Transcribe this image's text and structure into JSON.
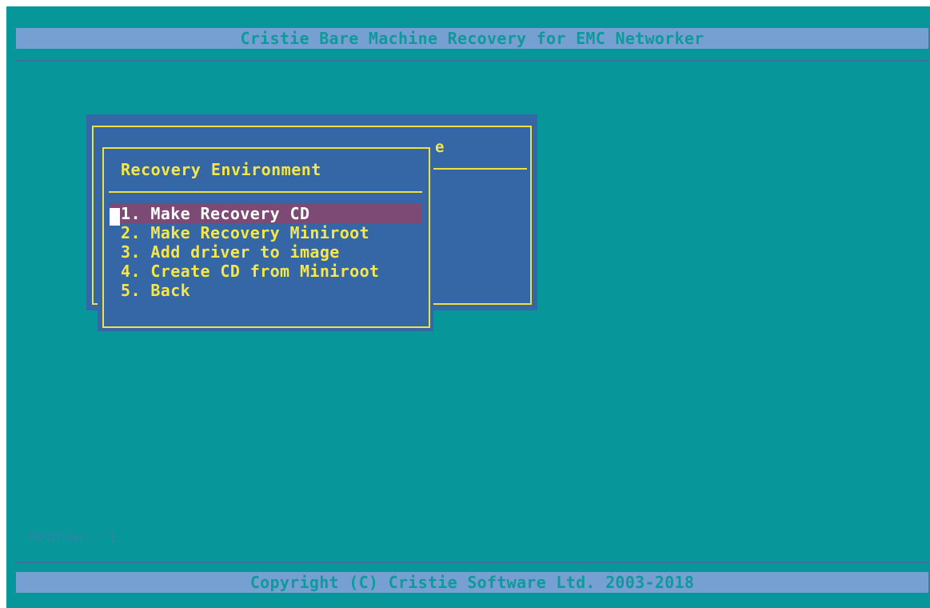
{
  "header": {
    "title": "Cristie Bare Machine Recovery for EMC Networker"
  },
  "footer": {
    "copyright": "Copyright (C) Cristie Software Ltd. 2003-2018",
    "redraw_hint": "Redraw: ^L"
  },
  "back_dialog": {
    "title_fragment": "e"
  },
  "dialog": {
    "title": "Recovery Environment",
    "selected_index": 0,
    "items": [
      {
        "label": "1. Make Recovery CD"
      },
      {
        "label": "2. Make Recovery Miniroot"
      },
      {
        "label": "3. Add driver to image"
      },
      {
        "label": "4. Create CD from Miniroot"
      },
      {
        "label": "5. Back"
      }
    ]
  },
  "colors": {
    "background": "#07979a",
    "dialog": "#3566a6",
    "border": "#f0e040",
    "text": "#f5e64a",
    "selection": "#7c4a75"
  }
}
